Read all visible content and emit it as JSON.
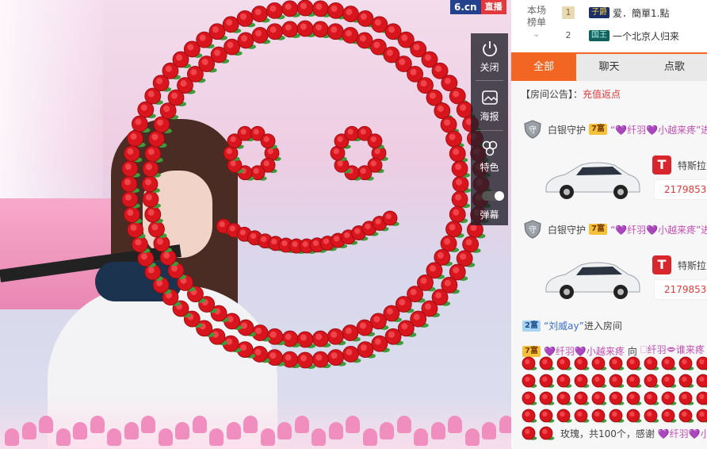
{
  "overlay": {
    "logo_site": "6.cn",
    "logo_live": "直播"
  },
  "toolbar": {
    "close_label": "关闭",
    "poster_label": "海报",
    "color_label": "特色",
    "danmaku_label": "弹幕"
  },
  "rank": {
    "title_line1": "本场",
    "title_line2": "榜单",
    "rows": [
      {
        "num": "1",
        "badge": "子爵",
        "name": "爱．簡單1.點"
      },
      {
        "num": "2",
        "badge": "国王",
        "name": "一个北京人归来"
      }
    ]
  },
  "tabs": [
    "全部",
    "聊天",
    "点歌"
  ],
  "chat": {
    "notice_label": "【房间公告】：",
    "notice_value": "充值返点",
    "guard1": {
      "role": "白银守护",
      "level": "7富",
      "user": "“💜纤羽💜小越来疼”进"
    },
    "car1": {
      "name": "特斯拉",
      "num": "2179853"
    },
    "guard2": {
      "role": "白银守护",
      "level": "7富",
      "user": "“💜纤羽💜小越来疼”进"
    },
    "car2": {
      "name": "特斯拉",
      "num": "2179853"
    },
    "enter": {
      "level": "2富",
      "user": "“刘威ay”",
      "action": "进入房间"
    },
    "gift_header": {
      "level": "7富",
      "from": "💜纤羽💜小越来疼",
      "to_word": "向",
      "to": "🗆纤羽🗢谁来疼"
    },
    "gift_text_pre": "玫瑰，共100个，感谢",
    "gift_text_user": "💜纤羽💜小越"
  },
  "colors": {
    "accent": "#f26522",
    "rose": "#e4393c"
  }
}
